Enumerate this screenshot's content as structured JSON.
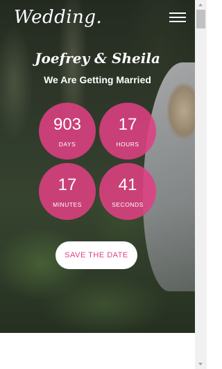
{
  "header": {
    "logo_text": "Wedding.",
    "menu_icon": "hamburger-icon"
  },
  "hero": {
    "couple_names": "Joefrey & Sheila",
    "tagline": "We Are Getting Married",
    "countdown": [
      {
        "value": "903",
        "unit": "DAYS"
      },
      {
        "value": "17",
        "unit": "HOURS"
      },
      {
        "value": "17",
        "unit": "MINUTES"
      },
      {
        "value": "41",
        "unit": "SECONDS"
      }
    ],
    "cta_label": "SAVE THE DATE"
  },
  "colors": {
    "accent": "#de4082",
    "text_on_dark": "#ffffff"
  }
}
